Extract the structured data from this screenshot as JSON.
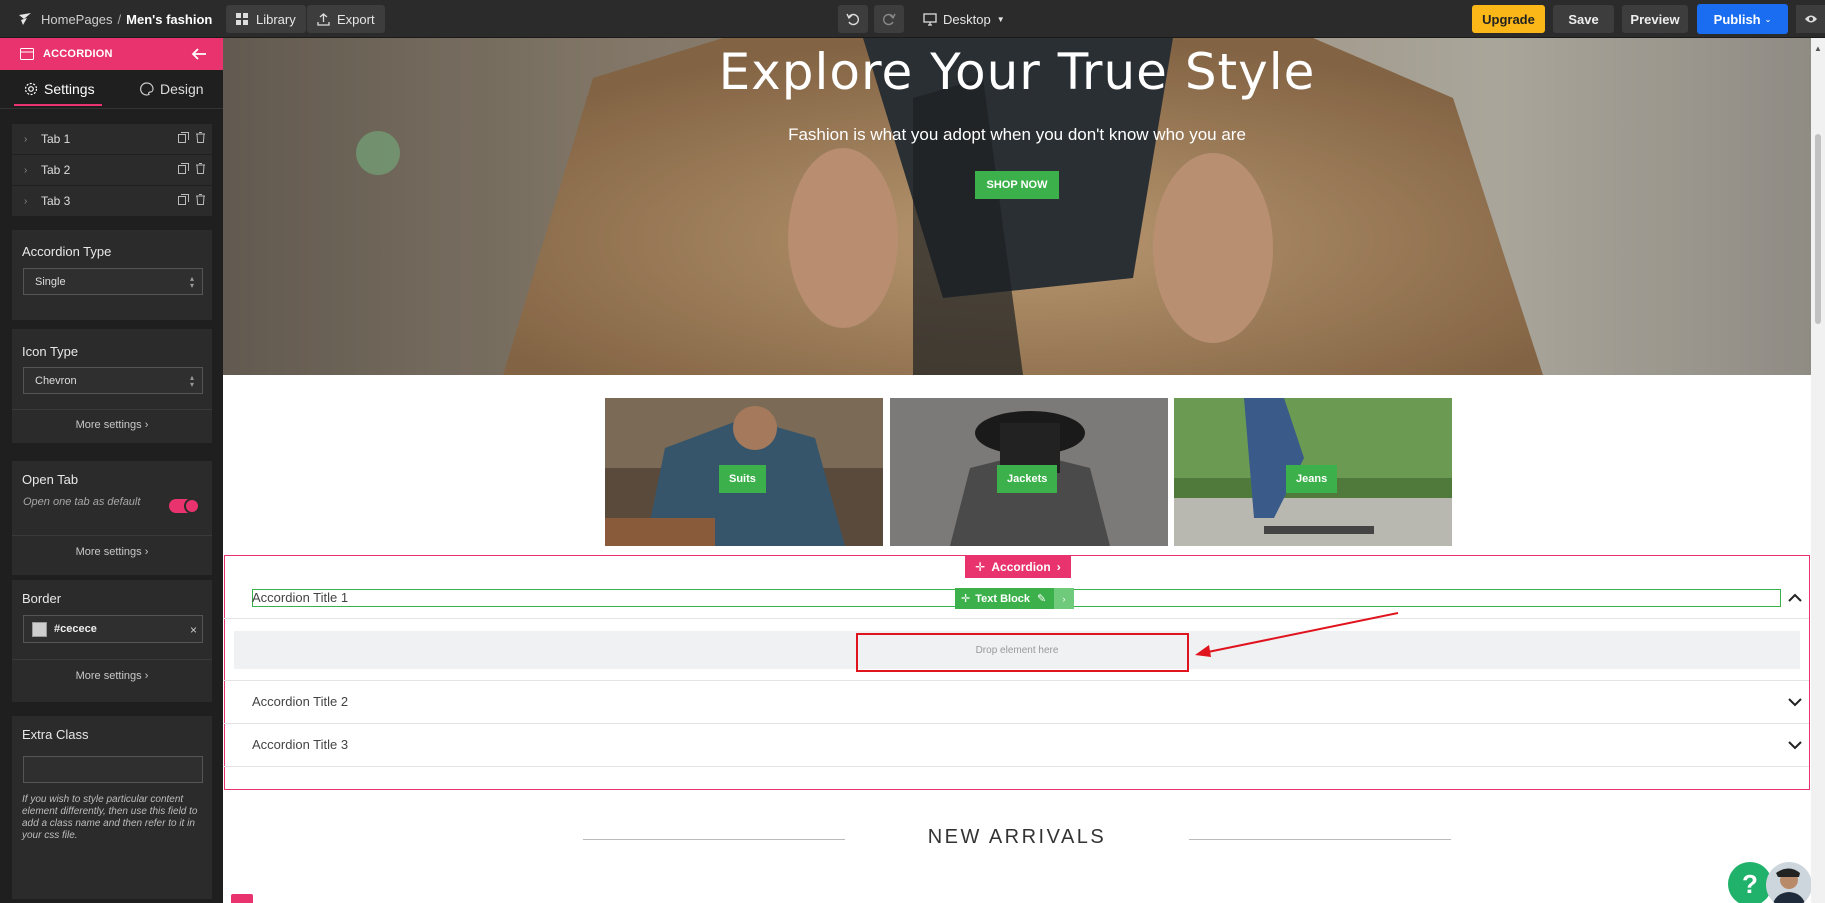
{
  "topbar": {
    "crumb_root": "HomePages",
    "crumb_sep": "/",
    "crumb_current": "Men's fashion",
    "library_label": "Library",
    "export_label": "Export",
    "device_label": "Desktop",
    "upgrade_label": "Upgrade",
    "save_label": "Save",
    "preview_label": "Preview",
    "publish_label": "Publish"
  },
  "sidebar": {
    "element_title": "ACCORDION",
    "tabs": {
      "settings": "Settings",
      "design": "Design"
    },
    "items": [
      {
        "label": "Tab 1"
      },
      {
        "label": "Tab 2"
      },
      {
        "label": "Tab 3"
      }
    ],
    "accordion_type": {
      "label": "Accordion Type",
      "value": "Single"
    },
    "icon_type": {
      "label": "Icon Type",
      "value": "Chevron"
    },
    "more_settings": "More settings",
    "open_tab": {
      "label": "Open Tab",
      "hint": "Open one tab as default",
      "enabled": true
    },
    "border": {
      "label": "Border",
      "color_value": "#cecece"
    },
    "extra_class": {
      "label": "Extra Class",
      "value": "",
      "help": "If you wish to style particular content element differently, then use this field to add a class name and then refer to it in your css file."
    }
  },
  "canvas": {
    "hero": {
      "title": "Explore Your True Style",
      "subtitle": "Fashion is what you adopt when you don't know who you are",
      "cta": "SHOP NOW"
    },
    "categories": [
      {
        "label": "Suits"
      },
      {
        "label": "Jackets"
      },
      {
        "label": "Jeans"
      }
    ],
    "accordion": {
      "badge": "Accordion",
      "text_block_badge": "Text Block",
      "drop_hint": "Drop element here",
      "items": [
        {
          "title": "Accordion Title 1",
          "open": true
        },
        {
          "title": "Accordion Title 2",
          "open": false
        },
        {
          "title": "Accordion Title 3",
          "open": false
        }
      ]
    },
    "new_arrivals": "NEW ARRIVALS",
    "help_fab": "?"
  },
  "colors": {
    "accent_pink": "#e8336e",
    "publish_blue": "#1a6cf0",
    "upgrade_yellow": "#fbb617",
    "green": "#3cb14b",
    "highlight_red": "#e0141e"
  }
}
